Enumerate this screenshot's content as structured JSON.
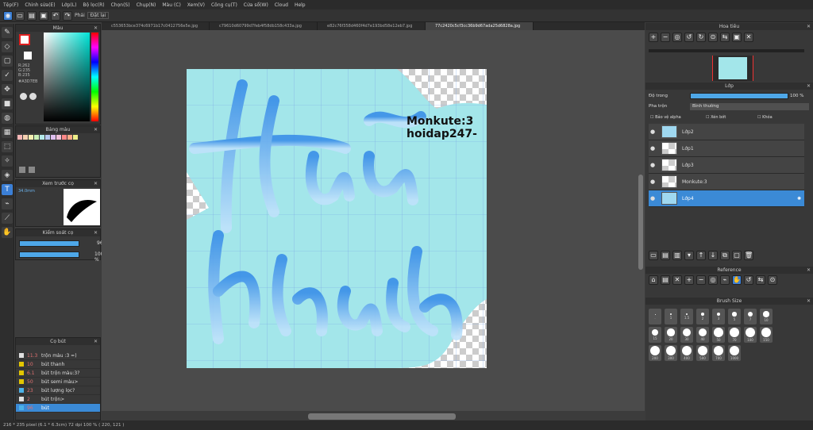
{
  "menu": [
    "Tệp(F)",
    "Chỉnh sửa(E)",
    "Lớp(L)",
    "Bộ lọc(R)",
    "Chọn(S)",
    "Chụp(N)",
    "Màu (C)",
    "Xem(V)",
    "Công cụ(T)",
    "Cửa sổ(W)",
    "Cloud",
    "Help"
  ],
  "toolbar": {
    "undo": "↶",
    "redo": "↷",
    "lock_label": "Phải",
    "unlock_label": "Đặt lại"
  },
  "tabs": [
    "c553653bce374c6971b17c0412756e5e.jpg",
    "c79610d60799d7feb4f58db158c433a.jpg",
    "e82c76f358d460f4d7e193bd58e12eb7.jpg",
    "77c2420c5cf3cc36b9d67ada25d6828a.jpg"
  ],
  "left": {
    "color_title": "Màu",
    "rgb": [
      "R:262",
      "G:235",
      "B:235"
    ],
    "hex": "#A3D7EB",
    "palette_title": "Bảng màu",
    "preview_title": "Xem trước cọ",
    "brush_size_label": "34.0mm",
    "tool_title": "Kiểm soát cọ",
    "size_val": "96",
    "opacity_val": "100 %",
    "pen_title": "Cọ bút"
  },
  "pens": [
    {
      "n": "11.3",
      "name": "trộn màu :3 =)",
      "c": "#e0e0e0"
    },
    {
      "n": "10",
      "name": "bút thanh",
      "c": "#e3c600"
    },
    {
      "n": "6.1",
      "name": "bút trộn màu:3?",
      "c": "#e3c600"
    },
    {
      "n": "50",
      "name": "bút semi màu>",
      "c": "#e3c600"
    },
    {
      "n": "23",
      "name": "bút lượng lọc?",
      "c": "#4cb1e8"
    },
    {
      "n": "2",
      "name": "bút trộn>",
      "c": "#e0e0e0"
    },
    {
      "n": "96",
      "name": "bút",
      "c": "#4cb1e8"
    }
  ],
  "canvas": {
    "watermark1": "Monkute:3",
    "watermark2": "hoidap247-"
  },
  "status": "216 * 235 pixel  (6.1 * 6.3cm)  72 dpi  100 %  ( 220, 121 )",
  "right": {
    "nav_title": "Hoa tiêu",
    "layer_title": "Lớp",
    "opacity_label": "Độ trong",
    "opacity_val": "100 %",
    "blend_label": "Pha trộn",
    "blend_val": "Bình thường",
    "protect_label": "Bảo vệ alpha",
    "clip_label": "Xén bớt",
    "lock_label": "Khóa",
    "ref_title": "Reference",
    "brushsize_title": "Brush Size"
  },
  "layers": [
    {
      "name": "Lớp2",
      "sel": false
    },
    {
      "name": "Lớp1",
      "sel": false
    },
    {
      "name": "Lớp3",
      "sel": false
    },
    {
      "name": "Monkute:3",
      "sel": false
    },
    {
      "name": "Lớp4",
      "sel": true
    }
  ],
  "brush_sizes": [
    ".",
    "1",
    "1.5",
    "2",
    "3",
    "5",
    "7",
    "10",
    "15",
    "20",
    "30",
    "40",
    "50",
    "70",
    "100",
    "150",
    "200",
    "300",
    "400",
    "500",
    "700",
    "1000"
  ],
  "colors": {
    "accent": "#3b8ad6",
    "canvas_blue": "#a3e6ea"
  }
}
